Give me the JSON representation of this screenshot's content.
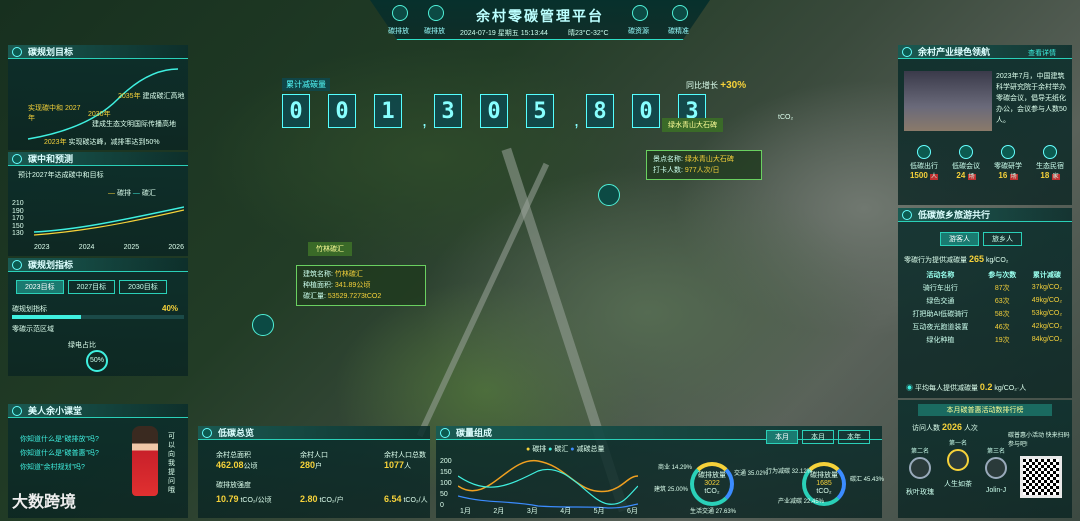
{
  "header": {
    "title": "余村零碳管理平台",
    "nav_left": [
      "碳排放",
      "碳排放"
    ],
    "nav_right": [
      "碳资源",
      "碳精准"
    ],
    "datetime": "2024-07-19 星期五 15:13:44",
    "weather": "晴23°C-32°C"
  },
  "goals": {
    "title": "碳规划目标",
    "items": [
      {
        "year": "2035年",
        "text": "建成碳汇高地"
      },
      {
        "year": "2030年",
        "text": "建成生态文明国际传播高地"
      },
      {
        "year": "实现碳中和 2027年",
        "text": ""
      },
      {
        "year": "2023年",
        "text": "实现碳达峰，减排率达到50%"
      }
    ]
  },
  "forecast": {
    "title": "碳中和预测",
    "subtitle": "预计2027年达成碳中和目标",
    "legend": [
      "碳排",
      "碳汇"
    ],
    "yticks": [
      "210",
      "190",
      "170",
      "150",
      "130"
    ],
    "xticks": [
      "2023",
      "2024",
      "2025",
      "2026"
    ]
  },
  "indicators": {
    "title": "碳规划指标",
    "tabs": [
      "2023目标",
      "2027目标",
      "2030目标"
    ],
    "label1": "碳规划指标",
    "pct": "40%",
    "label2": "零碳示范区域",
    "label3": "绿电占比",
    "ring": "50%"
  },
  "counter": {
    "label": "累计减碳量",
    "digits": [
      "0",
      "0",
      "1",
      ",",
      "3",
      "0",
      "5",
      ",",
      "8",
      "0",
      "3"
    ],
    "unit": "tCO₂",
    "growth_label": "同比增长",
    "growth": "+30%"
  },
  "spot1": {
    "title": "竹林碳汇",
    "name_label": "建筑名称:",
    "name": "竹林碳汇",
    "area_label": "种植面积:",
    "area": "341.89公顷",
    "amount_label": "碳汇量:",
    "amount": "53529.7273tCO2"
  },
  "spot2": {
    "title": "绿水青山大石碑",
    "name_label": "景点名称:",
    "name": "绿水青山大石碑",
    "count_label": "打卡人数:",
    "count": "977人次/日"
  },
  "lesson": {
    "title": "美人余小课堂",
    "q1": "你知道什么是\"碳排放\"吗?",
    "q2": "你知道什么是\"碳普惠\"吗?",
    "q3": "你知道\"余村规划\"吗?",
    "side": "可以向我提问哦",
    "brand": "大数跨境"
  },
  "overview": {
    "title": "低碳总览",
    "items": [
      {
        "label": "余村总面积",
        "value": "462.08",
        "unit": "公顷"
      },
      {
        "label": "余村人口",
        "value": "280",
        "unit": "户"
      },
      {
        "label": "余村人口总数",
        "value": "1077",
        "unit": "人"
      }
    ],
    "items2": [
      {
        "label": "碳排放强度",
        "value": "10.79",
        "unit": "tCO₂/公顷"
      },
      {
        "label": "",
        "value": "2.80",
        "unit": "tCO₂/户"
      },
      {
        "label": "",
        "value": "6.54",
        "unit": "tCO₂/人"
      }
    ]
  },
  "composition": {
    "title": "碳量组成",
    "legend": [
      "碳排",
      "碳汇",
      "减碳总量"
    ],
    "tabs": [
      "本月",
      "本月",
      "本年"
    ],
    "yticks": [
      "200",
      "150",
      "100",
      "50",
      "0"
    ],
    "xticks": [
      "1月",
      "2月",
      "3月",
      "4月",
      "5月",
      "6月"
    ],
    "donut1": {
      "label": "碳排放量",
      "value": "3022",
      "unit": "tCO₂",
      "parts": [
        "商业 14.29%",
        "交通 35.02%",
        "建筑 25.00%",
        "生活交通 27.63%"
      ]
    },
    "donut2": {
      "label": "碳排放量",
      "value": "1685",
      "unit": "tCO₂",
      "parts": [
        "行为减碳 32.12%",
        "产业减碳 22.45%",
        "碳汇 45.43%"
      ]
    }
  },
  "industry": {
    "title": "余村产业绿色领航",
    "more": "查看详情",
    "text": "2023年7月，中国建筑科学研究院于余村举办零碳会议，倡导无纸化办公，会议参与人数50人。",
    "icons": [
      {
        "label": "低碳出行",
        "value": "1500",
        "unit": "人"
      },
      {
        "label": "低碳会议",
        "value": "24",
        "unit": "场"
      },
      {
        "label": "零碳研学",
        "value": "16",
        "unit": "场"
      },
      {
        "label": "生态民宿",
        "value": "18",
        "unit": "家"
      }
    ]
  },
  "travel": {
    "title": "低碳旅乡旅游共行",
    "tabs": [
      "游客人",
      "旅乡人"
    ],
    "summary_label": "零碳行为提供减碳量",
    "summary_value": "265",
    "summary_unit": "kg/CO₂",
    "headers": [
      "活动名称",
      "参与次数",
      "累计减碳"
    ],
    "rows": [
      [
        "骑行车出行",
        "87次",
        "37kg/CO₂"
      ],
      [
        "绿色交通",
        "63次",
        "49kg/CO₂"
      ],
      [
        "打把助AI低碳骑行",
        "58次",
        "53kg/CO₂"
      ],
      [
        "互动夜光跑道装置",
        "46次",
        "42kg/CO₂"
      ],
      [
        "绿化种植",
        "19次",
        "84kg/CO₂"
      ]
    ],
    "avg_label": "平均每人提供减碳量",
    "avg_value": "0.2",
    "avg_unit": "kg/CO₂·人"
  },
  "ranking": {
    "title": "本月碳普惠活动数排行榜",
    "visits_label": "访问人数",
    "visits": "2026",
    "visits_unit": "人次",
    "hint": "碳普惠小活动 快来扫码参与吧!",
    "places": [
      {
        "rank": "第二名",
        "name": "秋叶玫瑰"
      },
      {
        "rank": "第一名",
        "name": "人生如茶"
      },
      {
        "rank": "第三名",
        "name": "Jolin-J"
      }
    ]
  },
  "colors": {
    "accent": "#3ff0e0",
    "yellow": "#f6d23a",
    "orange": "#f0a020",
    "blue": "#3b8cff"
  }
}
